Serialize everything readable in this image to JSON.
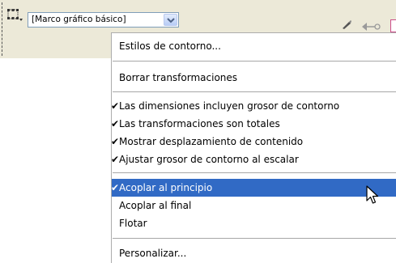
{
  "toolbar": {
    "frame_icon": "frame-grid-icon",
    "object_style_select": {
      "value": "[Marco gráfico básico]",
      "arrow_icon": "chevron-down-icon"
    },
    "pen_icon": "pen-icon",
    "arrowhead_icon": "arrowhead-icon",
    "stroke_style_icon": "stroke-style-icon"
  },
  "menu": {
    "items": [
      {
        "label": "Estilos de contorno...",
        "checked": false,
        "highlighted": false
      },
      {
        "label": "Borrar transformaciones",
        "checked": false,
        "highlighted": false
      },
      {
        "label": "Las dimensiones incluyen grosor de contorno",
        "checked": true,
        "highlighted": false
      },
      {
        "label": "Las transformaciones son totales",
        "checked": true,
        "highlighted": false
      },
      {
        "label": "Mostrar desplazamiento de contenido",
        "checked": true,
        "highlighted": false
      },
      {
        "label": "Ajustar grosor de contorno al escalar",
        "checked": true,
        "highlighted": false
      },
      {
        "label": "Acoplar al principio",
        "checked": true,
        "highlighted": true
      },
      {
        "label": "Acoplar al final",
        "checked": false,
        "highlighted": false
      },
      {
        "label": "Flotar",
        "checked": false,
        "highlighted": false
      },
      {
        "label": "Personalizar...",
        "checked": false,
        "highlighted": false
      }
    ],
    "check_glyph": "✔",
    "highlight_color": "#316ac5"
  },
  "cursor": "arrow-cursor-icon"
}
